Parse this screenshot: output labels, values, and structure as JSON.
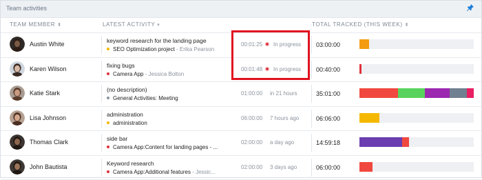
{
  "panel": {
    "title": "Team activities"
  },
  "header": {
    "team_member": "TEAM MEMBER",
    "latest_activity": "LATEST ACTIVITY",
    "total_tracked": "TOTAL TRACKED (THIS WEEK)"
  },
  "colors": {
    "red": "#e0303a",
    "orange": "#f39c12",
    "yellow": "#f5b800",
    "green": "#58d35d",
    "purple": "#8e24aa",
    "violet": "#6a3db0",
    "slate": "#708090",
    "pink": "#e91e63"
  },
  "rows": [
    {
      "name": "Austin White",
      "task": "keyword research for the landing page",
      "project": "SEO Optimization project",
      "client": " - Erika Pearson",
      "dot_color": "#f5b800",
      "time": "00:01:25",
      "status": "In progress",
      "in_progress": true,
      "total": "03:00:00",
      "segments": [
        {
          "color": "#f39c12",
          "share": 0.085
        }
      ]
    },
    {
      "name": "Karen Wilson",
      "task": "fixing bugs",
      "project": "Camera App",
      "client": " - Jessica Bolton",
      "dot_color": "#e0303a",
      "time": "00:01:48",
      "status": "In progress",
      "in_progress": true,
      "total": "00:40:00",
      "segments": [
        {
          "color": "#e0303a",
          "share": 0.02
        }
      ]
    },
    {
      "name": "Katie Stark",
      "task": "(no description)",
      "project": "General Activities: Meeting",
      "client": "",
      "dot_color": "#8a939d",
      "time": "01:00:00",
      "status": "in 21 hours",
      "in_progress": false,
      "total": "35:01:00",
      "segments": [
        {
          "color": "#f0483e",
          "share": 0.34
        },
        {
          "color": "#58d35d",
          "share": 0.23
        },
        {
          "color": "#9c27b0",
          "share": 0.22
        },
        {
          "color": "#708090",
          "share": 0.15
        },
        {
          "color": "#e91e63",
          "share": 0.06
        }
      ]
    },
    {
      "name": "Lisa Johnson",
      "task": "administration",
      "project": "administration",
      "client": "",
      "dot_color": "#f5b800",
      "time": "06:00:00",
      "status": "7 hours ago",
      "in_progress": false,
      "total": "06:06:00",
      "segments": [
        {
          "color": "#f5b800",
          "share": 0.175
        }
      ]
    },
    {
      "name": "Thomas Clark",
      "task": "side bar",
      "project": "Camera App:Content for landing pages - ...",
      "client": "",
      "dot_color": "#e0303a",
      "time": "02:00:00",
      "status": "a day ago",
      "in_progress": false,
      "total": "14:59:18",
      "segments": [
        {
          "color": "#6a3db0",
          "share": 0.375
        },
        {
          "color": "#f0483e",
          "share": 0.06
        }
      ]
    },
    {
      "name": "John Bautista",
      "task": "Keyword research",
      "project": "Camera App:Additional features",
      "client": " - Jessic...",
      "dot_color": "#e0303a",
      "time": "02:00:00",
      "status": "3 days ago",
      "in_progress": false,
      "total": "06:00:00",
      "segments": [
        {
          "color": "#f0483e",
          "share": 0.115
        }
      ]
    }
  ],
  "avatars": [
    {
      "skin": "#7a5a44",
      "hair": "#2b1d16",
      "bg": "#2f2a27"
    },
    {
      "skin": "#d8b9a6",
      "hair": "#3a2a24",
      "bg": "#cfd6de"
    },
    {
      "skin": "#c79b82",
      "hair": "#5a3b2a",
      "bg": "#a99c92"
    },
    {
      "skin": "#d3a68b",
      "hair": "#4a2e22",
      "bg": "#b6a293"
    },
    {
      "skin": "#8d664f",
      "hair": "#1f1714",
      "bg": "#3b3431"
    },
    {
      "skin": "#9a7458",
      "hair": "#201812",
      "bg": "#3e3834"
    }
  ]
}
